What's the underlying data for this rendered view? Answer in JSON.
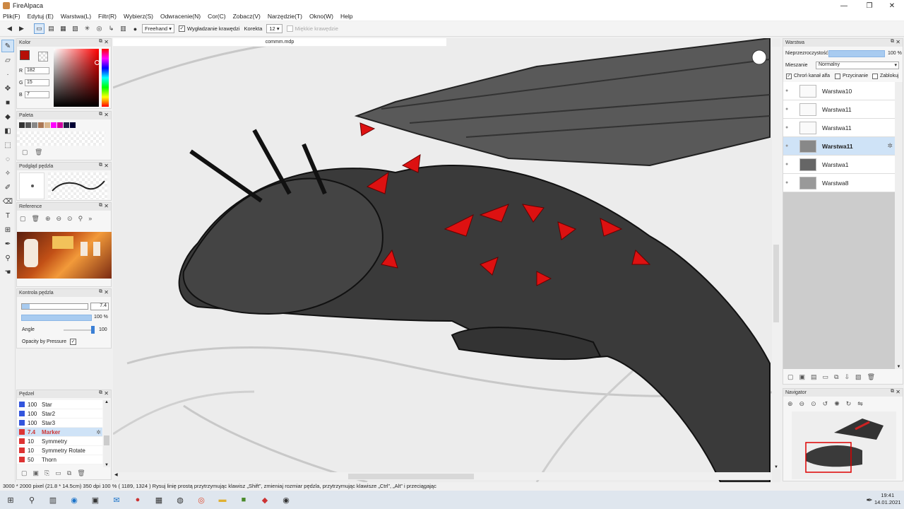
{
  "window": {
    "title": "FireAlpaca"
  },
  "menu": [
    "Plik(F)",
    "Edytuj (E)",
    "Warstwa(L)",
    "Filtr(R)",
    "Wybierz(S)",
    "Odwracenie(N)",
    "Cor(C)",
    "Zobacz(V)",
    "Narzędzie(T)",
    "Okno(W)",
    "Help"
  ],
  "toolbar": {
    "mode": "Freehand",
    "antialias_label": "Wygładzanie krawędzi",
    "correction_label": "Korekta",
    "correction_value": "12",
    "soft_edge_label": "Miękkie krawędzie"
  },
  "color_panel": {
    "title": "Kolor",
    "r_label": "R",
    "r": "182",
    "g_label": "G",
    "g": "15",
    "b_label": "B",
    "b": "7",
    "primary": "#b60f07"
  },
  "palette_panel": {
    "title": "Paleta",
    "swatches": [
      "#333333",
      "#555555",
      "#888888",
      "#aa7755",
      "#d8b48c",
      "#ff00ff",
      "#d000a0",
      "#222244",
      "#000033"
    ]
  },
  "brush_preview": {
    "title": "Podgląd pędzla"
  },
  "reference_panel": {
    "title": "Reference"
  },
  "brush_control": {
    "title": "Kontrola pędzla",
    "size": "7.4",
    "opacity": "100 %",
    "angle_label": "Angle",
    "angle": "100",
    "pressure_label": "Opacity by Pressure"
  },
  "brush_panel": {
    "title": "Pędzel",
    "items": [
      {
        "size": "100",
        "name": "Star",
        "color": "#3355dd"
      },
      {
        "size": "100",
        "name": "Star2",
        "color": "#3355dd"
      },
      {
        "size": "100",
        "name": "Star3",
        "color": "#3355dd"
      },
      {
        "size": "7.4",
        "name": "Marker",
        "color": "#dd3333"
      },
      {
        "size": "10",
        "name": "Symmetry",
        "color": "#dd3333"
      },
      {
        "size": "10",
        "name": "Symmetry Rotate",
        "color": "#dd3333"
      },
      {
        "size": "50",
        "name": "Thorn",
        "color": "#dd3333"
      }
    ],
    "selected": 3
  },
  "document": {
    "tab": "commm.mdp"
  },
  "layer_panel": {
    "title": "Warstwa",
    "opacity_label": "Nieprzezroczystość",
    "opacity": "100 %",
    "blend_label": "Mieszanie",
    "blend": "Normalny",
    "protect_alpha": "Chroń kanał alfa",
    "clipping": "Przycinanie",
    "lock": "Zablokuj",
    "layers": [
      "Warstwa10",
      "Warstwa11",
      "Warstwa11",
      "Warstwa11",
      "Warstwa1",
      "Warstwa8"
    ],
    "selected": 3
  },
  "navigator": {
    "title": "Navigator"
  },
  "status": {
    "text": "3000 * 2000 pixel   (21.8 * 14.5cm)   350 dpi   100 %   ( 1189, 1324 )   Rysuj linię prostą przytrzymując klawisz „Shift”, zmieniaj rozmiar pędzla, przytrzymując klawisze „Ctrl”, „Alt” i przeciągając"
  },
  "taskbar": {
    "time": "19:41",
    "date": "14.01.2021"
  }
}
